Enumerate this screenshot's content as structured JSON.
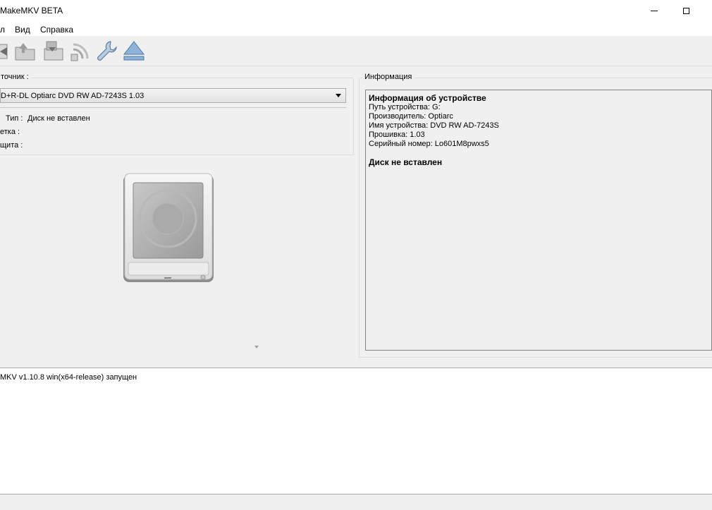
{
  "window": {
    "title": "MakeMKV BETA",
    "minimize_icon": "minimize-icon",
    "maximize_icon": "maximize-icon"
  },
  "menu": [
    {
      "label": "л"
    },
    {
      "label": "Вид"
    },
    {
      "label": "Справка"
    }
  ],
  "toolbar": [
    {
      "name": "open-files-button",
      "icon": "open-file-icon"
    },
    {
      "name": "open-disc-button",
      "icon": "open-disc-icon"
    },
    {
      "name": "backup-button",
      "icon": "backup-icon"
    },
    {
      "name": "stream-button",
      "icon": "stream-icon"
    },
    {
      "name": "settings-button",
      "icon": "wrench-icon"
    },
    {
      "name": "eject-button",
      "icon": "eject-icon"
    }
  ],
  "source": {
    "group_label": "точник :",
    "selected_drive": "D+R-DL Optiarc DVD RW AD-7243S 1.03",
    "type_label": "Тип :",
    "type_value": "Диск не вставлен",
    "label_label": "етка :",
    "protection_label": "щита :"
  },
  "info": {
    "group_label": "Информация",
    "heading": "Информация об устройстве",
    "lines": [
      "Путь устройства: G:",
      "Производитель: Optiarc",
      "Имя устройства: DVD RW AD-7243S",
      "Прошивка: 1.03",
      "Серийный номер: Lo601M8pwxs5"
    ],
    "status": "Диск не вставлен"
  },
  "log": {
    "lines": [
      "MKV v1.10.8 win(x64-release) запущен"
    ]
  },
  "colors": {
    "log_bg": "#ffffff",
    "window_bg": "#f0f0f0"
  }
}
